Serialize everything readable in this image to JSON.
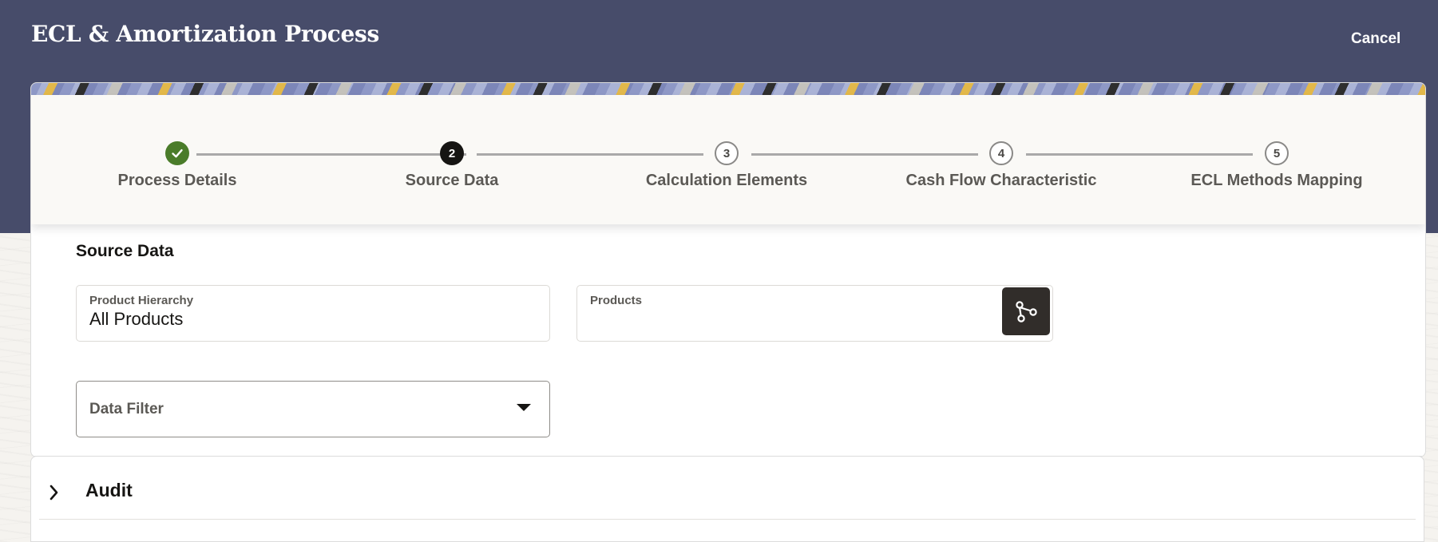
{
  "header": {
    "title": "ECL & Amortization Process",
    "cancel_label": "Cancel"
  },
  "train": {
    "steps": [
      {
        "number": "1",
        "label": "Process Details",
        "state": "completed"
      },
      {
        "number": "2",
        "label": "Source Data",
        "state": "current"
      },
      {
        "number": "3",
        "label": "Calculation Elements",
        "state": "upcoming"
      },
      {
        "number": "4",
        "label": "Cash Flow Characteristic",
        "state": "upcoming"
      },
      {
        "number": "5",
        "label": "ECL Methods Mapping",
        "state": "upcoming"
      }
    ]
  },
  "source_data": {
    "title": "Source Data",
    "product_hierarchy": {
      "label": "Product Hierarchy",
      "value": "All Products"
    },
    "products": {
      "label": "Products",
      "value": ""
    },
    "hierarchy_button_icon": "hierarchy-icon",
    "data_filter": {
      "placeholder": "Data Filter",
      "value": ""
    }
  },
  "audit": {
    "label": "Audit",
    "expanded": false
  },
  "colors": {
    "header_bg": "#474c6a",
    "completed": "#4a7c2a",
    "current": "#161513",
    "dark_button": "#312d2a"
  }
}
